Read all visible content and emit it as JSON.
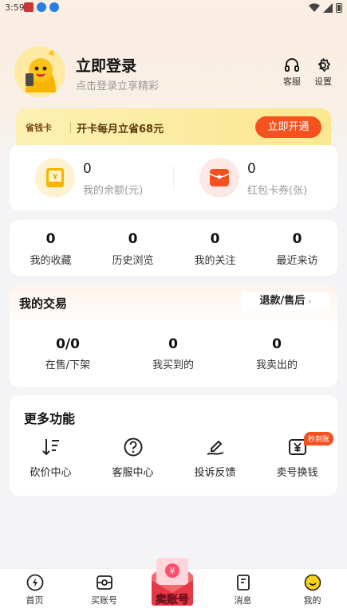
{
  "status_bar": {
    "time": "3:59"
  },
  "header": {
    "title": "立即登录",
    "subtitle": "点击登录立享精彩",
    "service_label": "客服",
    "settings_label": "设置"
  },
  "vip_banner": {
    "tag": "省钱卡",
    "text": "开卡每月立省68元",
    "button": "立即开通"
  },
  "wallet": {
    "balance_value": "0",
    "balance_label": "我的余额(元)",
    "coupon_value": "0",
    "coupon_label": "红包卡券(张)"
  },
  "stats": [
    {
      "value": "0",
      "label": "我的收藏"
    },
    {
      "value": "0",
      "label": "历史浏览"
    },
    {
      "value": "0",
      "label": "我的关注"
    },
    {
      "value": "0",
      "label": "最近来访"
    }
  ],
  "trade": {
    "title": "我的交易",
    "refund_button": "退款/售后",
    "items": [
      {
        "value": "0/0",
        "label": "在售/下架"
      },
      {
        "value": "0",
        "label": "我买到的"
      },
      {
        "value": "0",
        "label": "我卖出的"
      }
    ]
  },
  "more": {
    "title": "更多功能",
    "items": [
      {
        "label": "砍价中心",
        "icon": "sort-down-icon"
      },
      {
        "label": "客服中心",
        "icon": "question-circle-icon"
      },
      {
        "label": "投诉反馈",
        "icon": "pen-icon"
      },
      {
        "label": "卖号换钱",
        "icon": "yuan-box-icon",
        "badge": "秒到账"
      }
    ]
  },
  "tabbar": {
    "items": [
      {
        "label": "首页",
        "icon": "lightning-icon"
      },
      {
        "label": "买账号",
        "icon": "gamepad-icon"
      },
      {
        "label": "卖账号",
        "icon": "red-envelope-icon"
      },
      {
        "label": "消息",
        "icon": "message-icon"
      },
      {
        "label": "我的",
        "icon": "smile-icon"
      }
    ]
  },
  "colors": {
    "accent": "#f4511e",
    "vip_bg": "#fbe78f"
  }
}
